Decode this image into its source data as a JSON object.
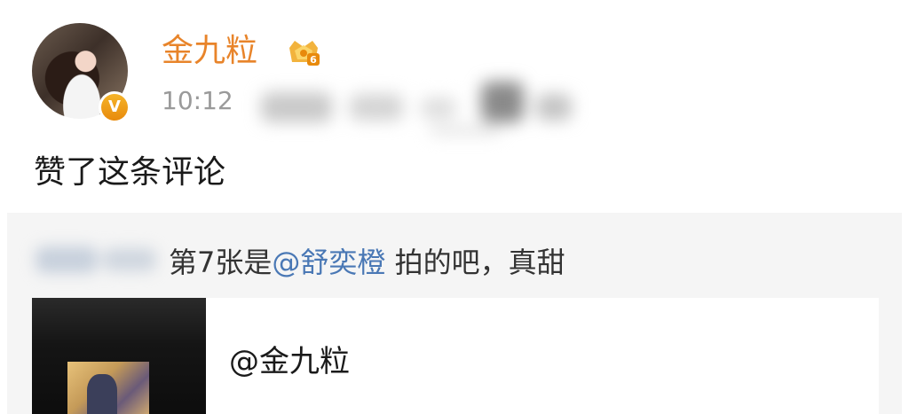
{
  "post": {
    "username": "金九粒",
    "time": "10:12",
    "text": "赞了这条评论",
    "verified_badge": "V",
    "member_level": "6",
    "colors": {
      "username": "#e8842a",
      "mention": "#4a78b5",
      "badge": "#f0a020"
    }
  },
  "quote": {
    "comment_prefix": "第7张是",
    "comment_mention": "@舒奕橙",
    "comment_suffix": " 拍的吧，真甜",
    "card_title": "@金九粒"
  },
  "icons": [
    "avatar",
    "verified-badge-icon",
    "crown-icon"
  ]
}
